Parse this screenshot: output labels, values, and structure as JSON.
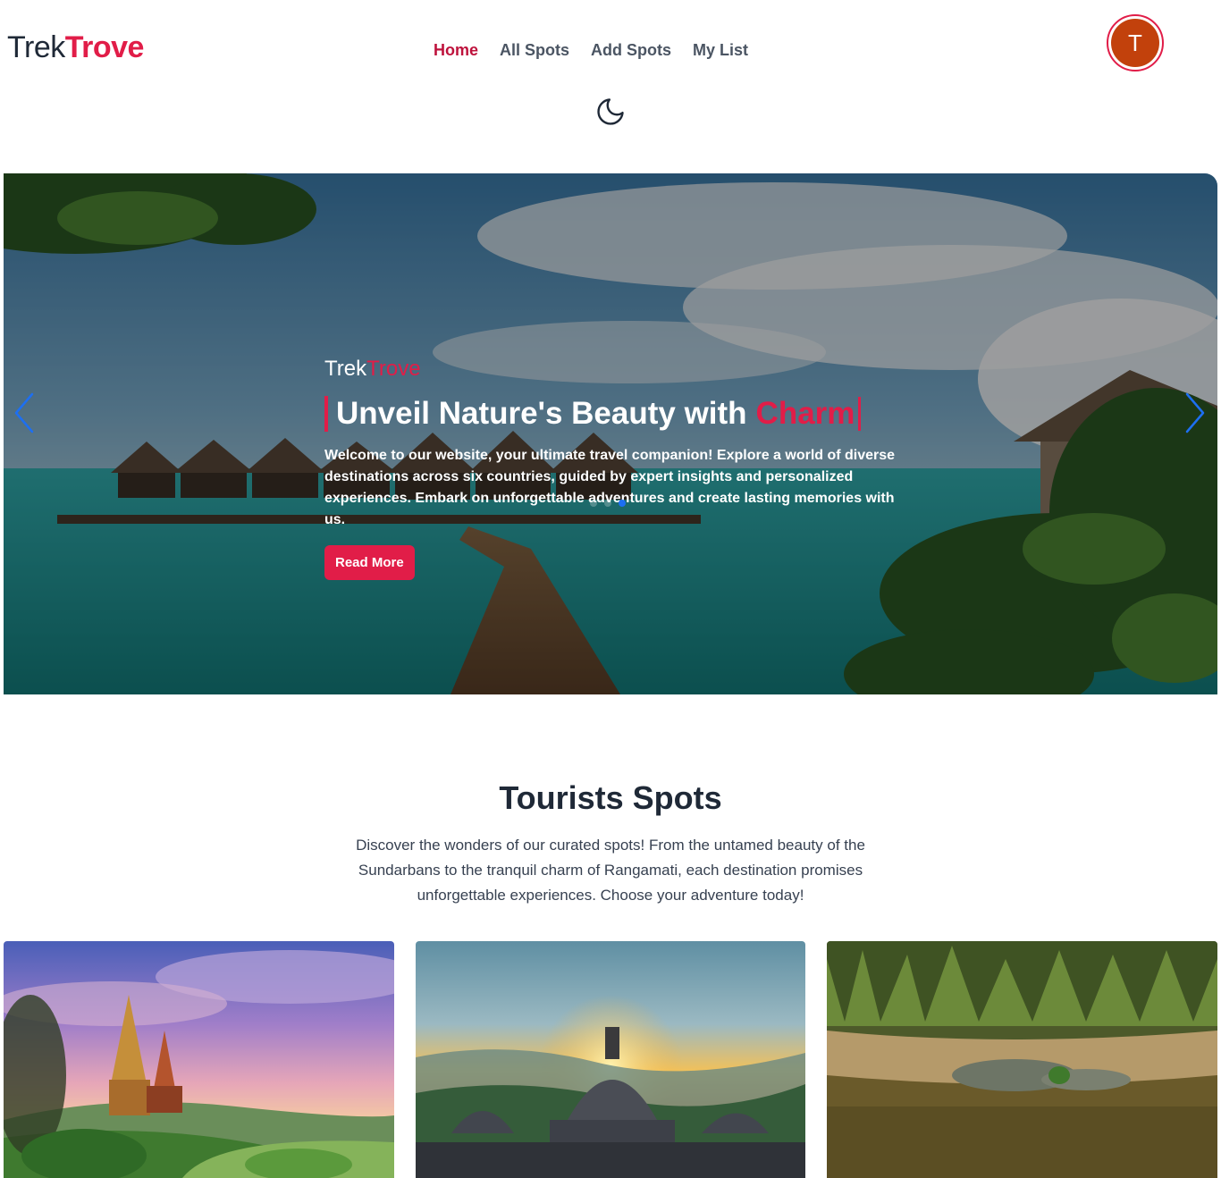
{
  "header": {
    "logo": {
      "part1": "Trek",
      "part2": "Trove"
    },
    "nav": [
      {
        "label": "Home",
        "active": true
      },
      {
        "label": "All Spots",
        "active": false
      },
      {
        "label": "Add Spots",
        "active": false
      },
      {
        "label": "My List",
        "active": false
      }
    ],
    "avatar_initial": "T",
    "theme_toggle_icon": "moon-icon"
  },
  "hero": {
    "brand": {
      "part1": "Trek",
      "part2": "Trove"
    },
    "title": "Unveil Nature's Beauty with",
    "title_accent": "Charm",
    "description": "Welcome to our website, your ultimate travel companion! Explore a world of diverse destinations across six countries, guided by expert insights and personalized experiences. Embark on unforgettable adventures and create lasting memories with us.",
    "button_label": "Read More",
    "prev_icon": "chevron-left-icon",
    "next_icon": "chevron-right-icon",
    "slides_count": 3,
    "active_slide": 3
  },
  "spots": {
    "title": "Tourists Spots",
    "description": "Discover the wonders of our curated spots! From the untamed beauty of the Sundarbans to the tranquil charm of Rangamati, each destination promises unforgettable experiences. Choose your adventure today!"
  },
  "colors": {
    "accent": "#e11d48",
    "nav_active": "#be123c",
    "avatar_bg": "#c2410c",
    "slider_arrow": "#1d6ff2"
  }
}
